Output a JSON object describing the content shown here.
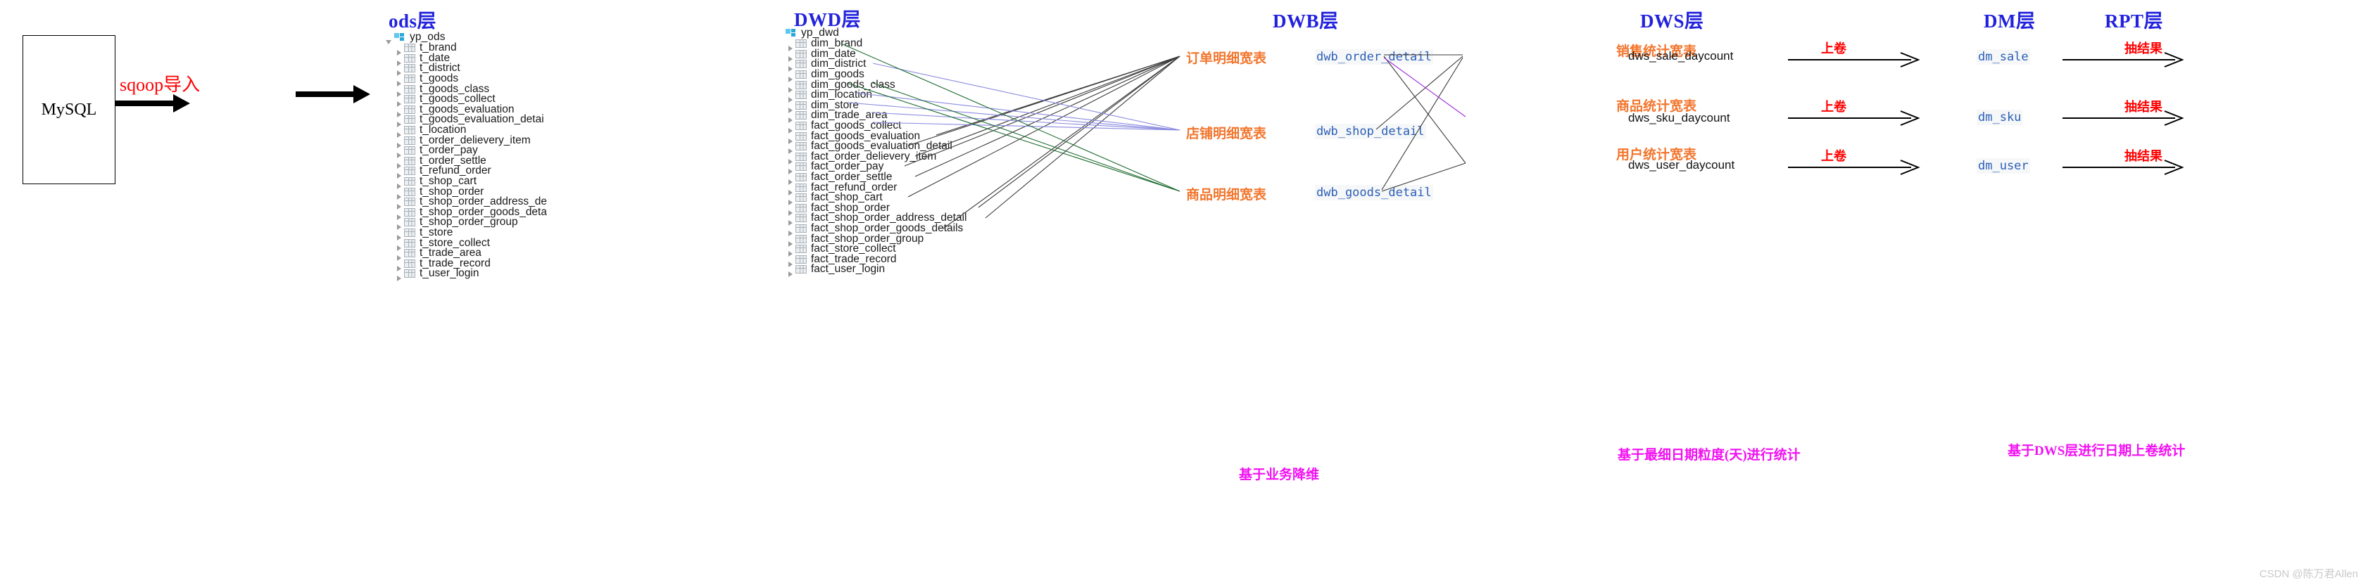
{
  "source": {
    "box_label": "MySQL",
    "ingest_label": "sqoop导入"
  },
  "layers": {
    "ods": "ods层",
    "dwd": "DWD层",
    "dwb": "DWB层",
    "dws": "DWS层",
    "dm": "DM层",
    "rpt": "RPT层"
  },
  "ods_tree": {
    "root": "yp_ods",
    "tables": [
      "t_brand",
      "t_date",
      "t_district",
      "t_goods",
      "t_goods_class",
      "t_goods_collect",
      "t_goods_evaluation",
      "t_goods_evaluation_detai",
      "t_location",
      "t_order_delievery_item",
      "t_order_pay",
      "t_order_settle",
      "t_refund_order",
      "t_shop_cart",
      "t_shop_order",
      "t_shop_order_address_de",
      "t_shop_order_goods_deta",
      "t_shop_order_group",
      "t_store",
      "t_store_collect",
      "t_trade_area",
      "t_trade_record",
      "t_user_login"
    ]
  },
  "dwd_tree": {
    "root": "yp_dwd",
    "tables": [
      "dim_brand",
      "dim_date",
      "dim_district",
      "dim_goods",
      "dim_goods_class",
      "dim_location",
      "dim_store",
      "dim_trade_area",
      "fact_goods_collect",
      "fact_goods_evaluation",
      "fact_goods_evaluation_detail",
      "fact_order_delievery_item",
      "fact_order_pay",
      "fact_order_settle",
      "fact_refund_order",
      "fact_shop_cart",
      "fact_shop_order",
      "fact_shop_order_address_detail",
      "fact_shop_order_goods_details",
      "fact_shop_order_group",
      "fact_store_collect",
      "fact_trade_record",
      "fact_user_login"
    ]
  },
  "dwb_tables": [
    {
      "cn": "订单明细宽表",
      "name": "dwb_order_detail"
    },
    {
      "cn": "店铺明细宽表",
      "name": "dwb_shop_detail"
    },
    {
      "cn": "商品明细宽表",
      "name": "dwb_goods_detail"
    }
  ],
  "dws_tables": [
    {
      "cn": "销售统计宽表",
      "name": "dws_sale_daycount"
    },
    {
      "cn": "商品统计宽表",
      "name": "dws_sku_daycount"
    },
    {
      "cn": "用户统计宽表",
      "name": "dws_user_daycount"
    }
  ],
  "dm_tables": [
    {
      "name": "dm_sale"
    },
    {
      "name": "dm_sku"
    },
    {
      "name": "dm_user"
    }
  ],
  "edge_labels": {
    "rollup": "上卷",
    "extract": "抽结果"
  },
  "notes": {
    "dwb": "基于业务降维",
    "dws": "基于最细日期粒度(天)进行统计",
    "dm": "基于DWS层进行日期上卷统计"
  },
  "watermark": "CSDN @陈万君Allen",
  "colors": {
    "layer_caption": "#2222dd",
    "cn_orange": "#f2762e",
    "mono_blue": "#2a5fb8",
    "red": "#ff0000",
    "magenta": "#f210f2",
    "green_edge": "#1d6b2f",
    "purple_edge": "#8a8ae0",
    "violet_edge": "#9b30d9",
    "black_edge": "#555555"
  }
}
